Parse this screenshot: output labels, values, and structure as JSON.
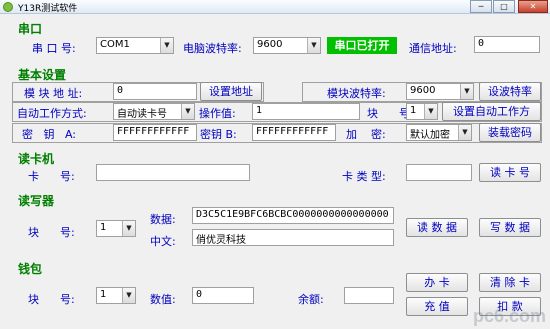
{
  "window": {
    "title": "Y13R测试软件",
    "min": "─",
    "max": "□",
    "close": "✕"
  },
  "serial": {
    "section": "串口",
    "port_label": "串 口 号:",
    "port_value": "COM1",
    "baud_label": "电脑波特率:",
    "baud_value": "9600",
    "status": "串口已打开",
    "addr_label": "通信地址:",
    "addr_value": "0"
  },
  "basic": {
    "section": "基本设置",
    "module_addr_label": "模 块 地 址:",
    "module_addr_value": "0",
    "set_addr_button": "设置地址",
    "module_baud_label": "模块波特率:",
    "module_baud_value": "9600",
    "set_baud_button": "设波特率",
    "auto_mode_label": "自动工作方式:",
    "auto_mode_value": "自动读卡号",
    "op_value_label": "操作值:",
    "op_value": "1",
    "block_label": "块      号:",
    "block_value": "1",
    "set_auto_button": "设置自动工作方",
    "key_a_label": "密   钥   A:",
    "key_a_value": "FFFFFFFFFFFF",
    "key_b_label": "密钥 B:",
    "key_b_value": "FFFFFFFFFFFF",
    "encrypt_label": "加    密:",
    "encrypt_value": "默认加密",
    "load_key_button": "装载密码"
  },
  "reader": {
    "section": "读卡机",
    "card_no_label": "卡      号:",
    "card_no_value": "",
    "card_type_label": "卡 类 型:",
    "card_type_value": "",
    "read_card_button": "读 卡 号"
  },
  "rw": {
    "section": "读写器",
    "block_label": "块      号:",
    "block_value": "1",
    "data_label": "数据:",
    "data_value": "D3C5C1E9BFC6BCBC0000000000000000",
    "chinese_label": "中文:",
    "chinese_value": "俏优灵科技",
    "read_data_button": "读 数 据",
    "write_data_button": "写 数 据"
  },
  "wallet": {
    "section": "钱包",
    "block_label": "块      号:",
    "block_value": "1",
    "amount_label": "数值:",
    "amount_value": "0",
    "balance_label": "余额:",
    "balance_value": "",
    "open_card_button": "办    卡",
    "clear_card_button": "清 除 卡",
    "recharge_button": "充    值",
    "deduct_button": "扣    款"
  },
  "watermark": "pc6.com"
}
